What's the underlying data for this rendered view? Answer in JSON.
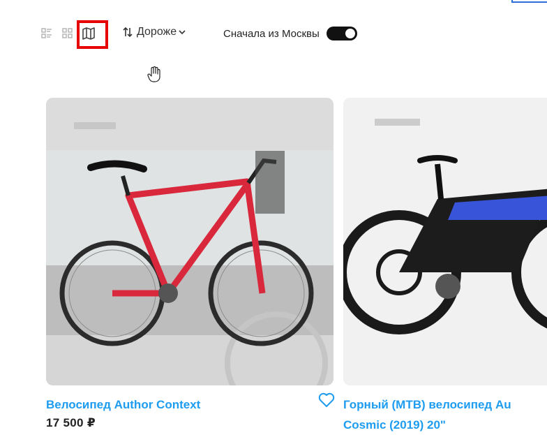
{
  "toolbar": {
    "views": [
      {
        "icon": "list-view-icon",
        "selected": false
      },
      {
        "icon": "grid-view-icon",
        "selected": false
      },
      {
        "icon": "map-view-icon",
        "selected": true
      }
    ],
    "sort_label": "Дороже",
    "moscow_label": "Сначала из Москвы",
    "moscow_toggle": true
  },
  "products": [
    {
      "title": "Велосипед Author Context",
      "price": "17 500 ₽",
      "image": "red-mountain-bike",
      "favorite_icon": "heart-outline-icon"
    },
    {
      "title_line1": "Горный (MTB) велосипед Au",
      "title_line2": "Cosmic (2019) 20\"",
      "image": "black-triathlon-bike"
    }
  ],
  "colors": {
    "accent": "#1e9cf0",
    "highlight": "#e60000",
    "toggle": "#111111"
  }
}
